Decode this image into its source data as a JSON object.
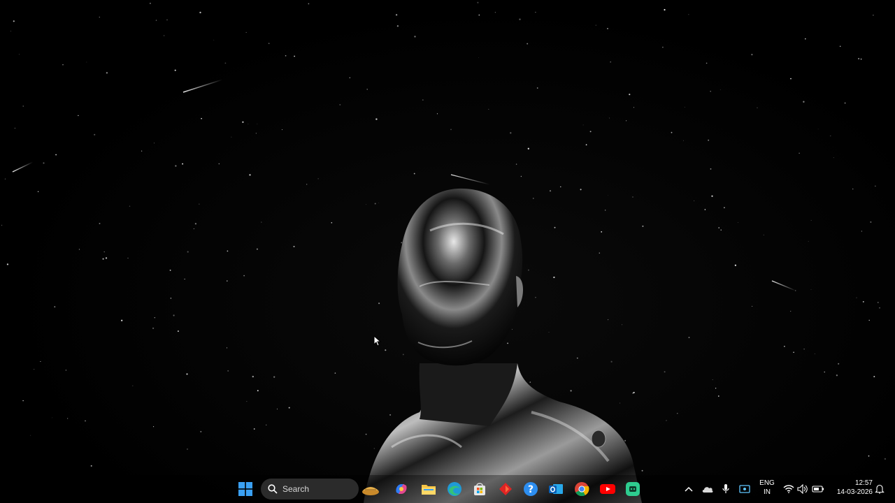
{
  "taskbar": {
    "search": {
      "label": "Search"
    },
    "apps": [
      {
        "name": "start",
        "icon": "windows-logo-icon"
      },
      {
        "name": "widgets",
        "icon": "pie-widget-icon"
      },
      {
        "name": "copilot",
        "icon": "copilot-icon"
      },
      {
        "name": "file-explorer",
        "icon": "folder-icon"
      },
      {
        "name": "edge",
        "icon": "edge-icon"
      },
      {
        "name": "microsoft-store",
        "icon": "store-icon"
      },
      {
        "name": "red-app",
        "icon": "red-diamond-icon"
      },
      {
        "name": "get-help",
        "icon": "help-icon"
      },
      {
        "name": "outlook",
        "icon": "outlook-icon"
      },
      {
        "name": "chrome",
        "icon": "chrome-icon"
      },
      {
        "name": "youtube",
        "icon": "youtube-icon"
      },
      {
        "name": "green-app",
        "icon": "green-app-icon"
      }
    ]
  },
  "tray": {
    "icons": [
      "chevron-up-icon",
      "onedrive-icon",
      "microphone-icon",
      "screen-capture-icon",
      "wifi-icon",
      "speaker-icon",
      "battery-icon",
      "notification-icon"
    ],
    "language": {
      "line1": "ENG",
      "line2": "IN"
    },
    "clock": {
      "time": "12:57",
      "date": "14-03-2026"
    }
  },
  "colors": {
    "accent_blue": "#3aa0f3",
    "folder_yellow": "#f6c445",
    "youtube_red": "#ff0000",
    "green_app": "#2ecc8f"
  }
}
